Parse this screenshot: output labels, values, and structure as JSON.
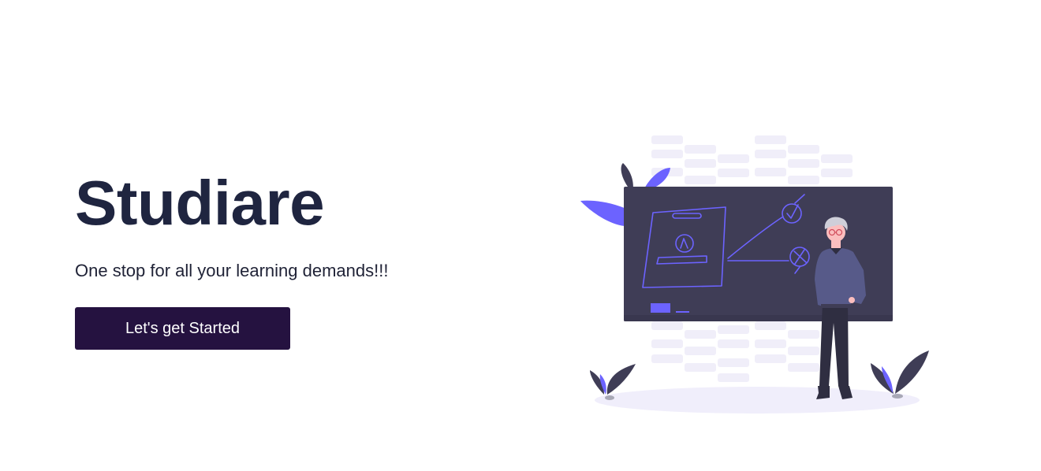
{
  "hero": {
    "title": "Studiare",
    "tagline": "One stop for all your learning demands!!!",
    "cta_label": "Let's get Started"
  },
  "illustration": {
    "name": "teacher-at-chalkboard-illustration",
    "colors": {
      "board": "#3f3d56",
      "accent": "#6c63ff",
      "grid_cells": "#f0eef9",
      "shirt": "#575a89",
      "pants": "#2f2e41",
      "ground": "#f0eefb"
    }
  },
  "theme": {
    "title_color": "#1f2540",
    "button_bg": "#251240",
    "button_text": "#ffffff"
  }
}
